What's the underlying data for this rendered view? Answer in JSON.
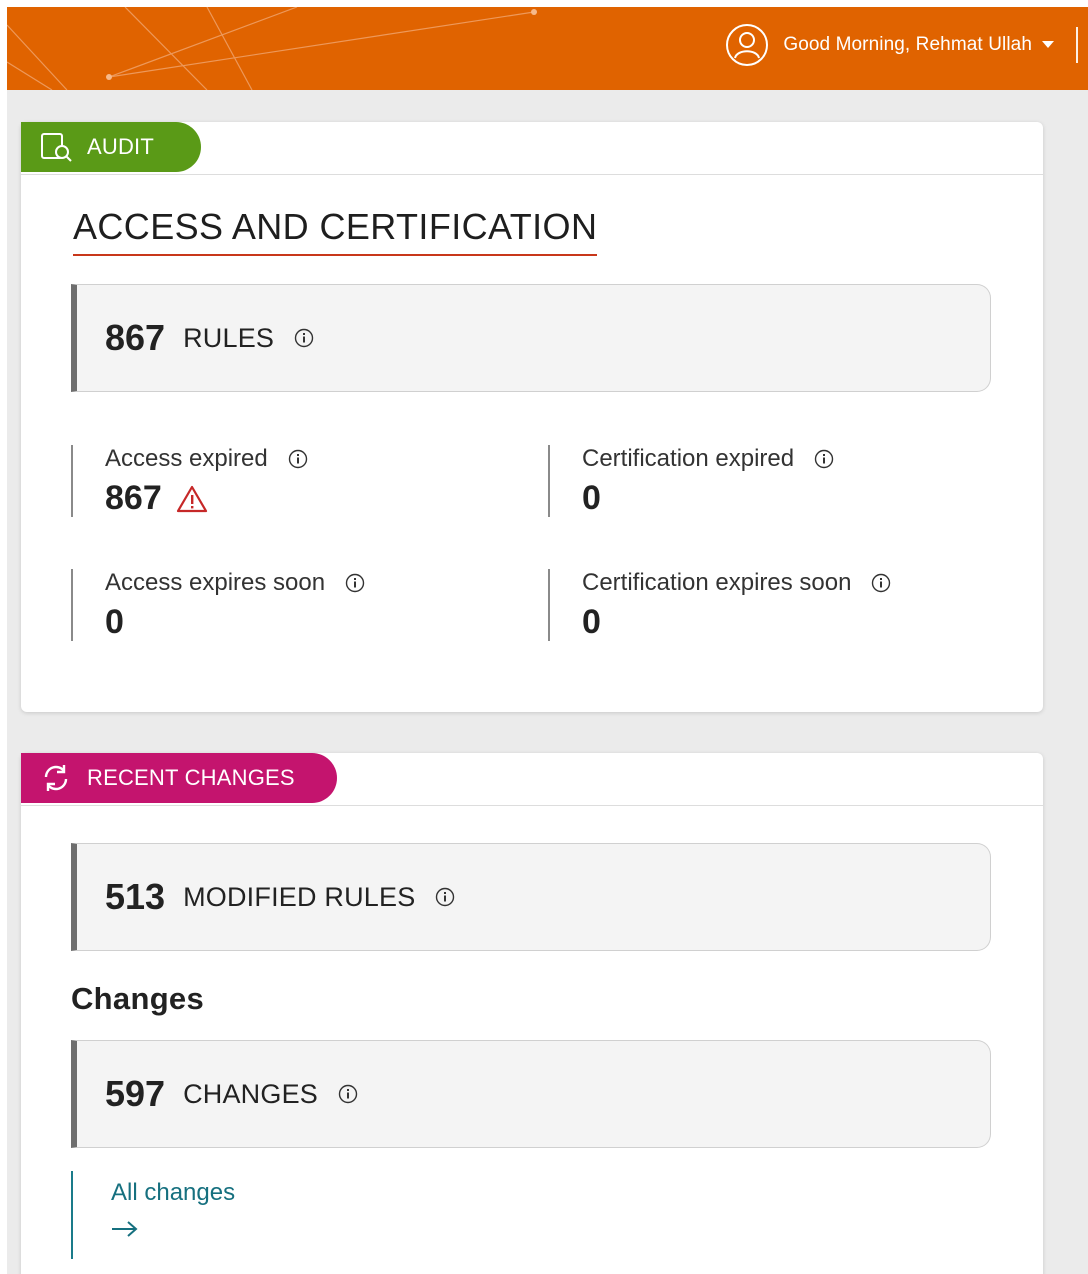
{
  "header": {
    "greeting": "Good Morning, Rehmat Ullah",
    "brand_color": "#e06300"
  },
  "audit": {
    "tab_label": "AUDIT",
    "tab_color": "#5a9a17",
    "section_title": "ACCESS AND CERTIFICATION",
    "rules": {
      "count": "867",
      "label": "RULES"
    },
    "metrics": [
      {
        "label": "Access expired",
        "value": "867",
        "warning": true
      },
      {
        "label": "Certification expired",
        "value": "0",
        "warning": false
      },
      {
        "label": "Access expires soon",
        "value": "0",
        "warning": false
      },
      {
        "label": "Certification expires soon",
        "value": "0",
        "warning": false
      }
    ]
  },
  "recent": {
    "tab_label": "RECENT CHANGES",
    "tab_color": "#c4146e",
    "modified": {
      "count": "513",
      "label": "MODIFIED RULES"
    },
    "changes_heading": "Changes",
    "changes": {
      "count": "597",
      "label": "CHANGES"
    },
    "all_changes_link": "All changes"
  },
  "icons": {
    "avatar": "user-avatar-icon",
    "caret": "caret-down-icon",
    "audit": "audit-search-icon",
    "recent": "refresh-icon",
    "info": "info-icon",
    "warning": "warning-triangle-icon",
    "arrow": "arrow-right-icon"
  }
}
